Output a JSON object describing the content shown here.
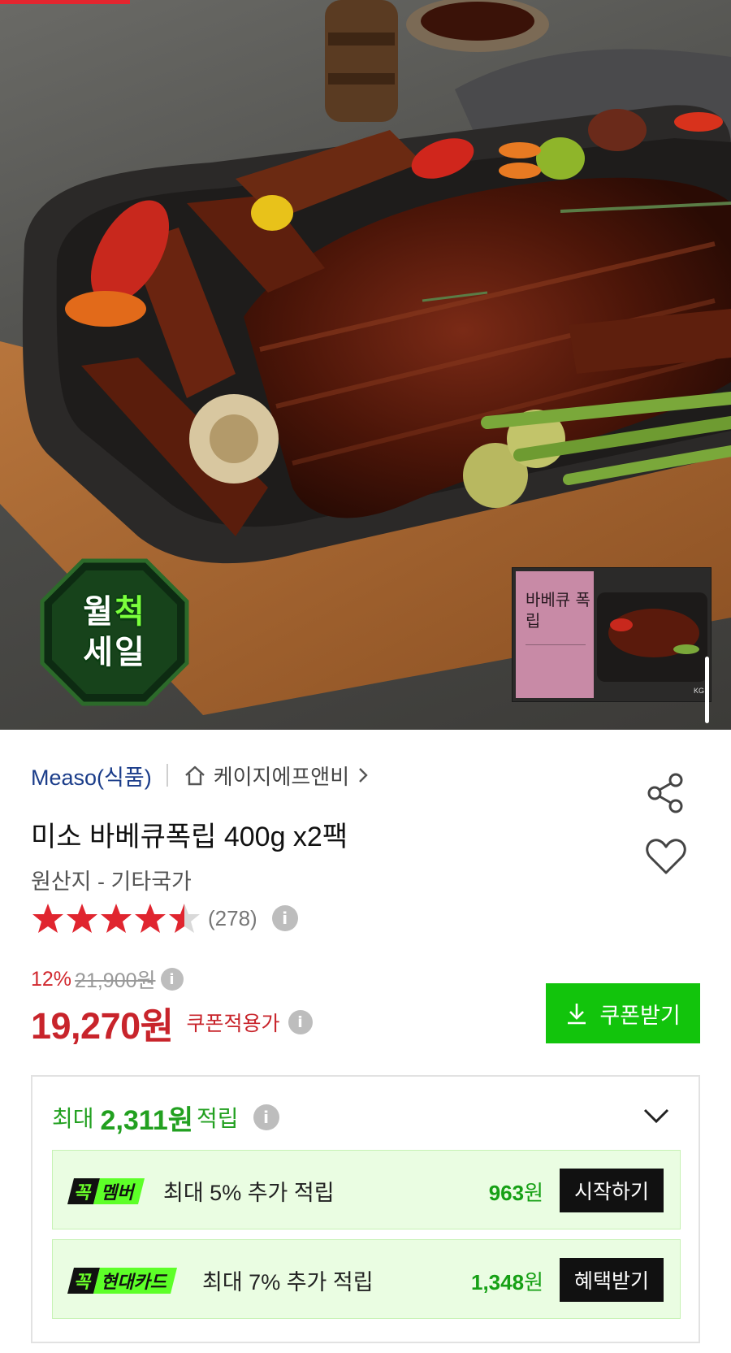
{
  "hero": {
    "badge_line1": "월",
    "badge_line1_hl": "척",
    "badge_line2": "세일",
    "thumb_title": "바베큐 폭립",
    "thumb_brand": "KG"
  },
  "product": {
    "brand": "Measo(식품)",
    "seller": "케이지에프앤비",
    "title": "미소 바베큐폭립 400g x2팩",
    "origin": "원산지 - 기타국가",
    "rating": 4.5,
    "review_count": "(278)",
    "discount_rate": "12%",
    "original_price": "21,900원",
    "price": "19,270원",
    "price_label": "쿠폰적용가",
    "coupon_button": "쿠폰받기"
  },
  "rewards": {
    "prefix": "최대",
    "amount": "2,311원",
    "suffix": "적립",
    "offers": [
      {
        "tag_k": "꼭",
        "tag_name": "멤버",
        "text": "최대 5% 추가 적립",
        "points_num": "963",
        "points_unit": "원",
        "button": "시작하기"
      },
      {
        "tag_k": "꼭",
        "tag_name": "현대카드",
        "text": "최대 7% 추가 적립",
        "points_num": "1,348",
        "points_unit": "원",
        "button": "혜택받기"
      }
    ]
  },
  "colors": {
    "accent_green": "#12c40c",
    "price_red": "#c8242b",
    "brand_blue": "#1b3d8a",
    "reward_bg": "#eafde2"
  },
  "icons": [
    "home-icon",
    "chevron-right-icon",
    "share-icon",
    "heart-icon",
    "star-icon",
    "info-icon",
    "download-icon",
    "chevron-down-icon"
  ]
}
